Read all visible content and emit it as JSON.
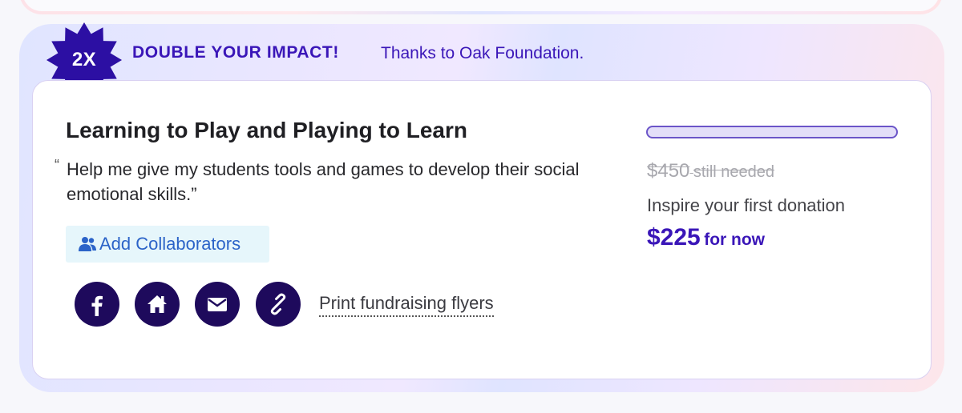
{
  "promo": {
    "badge_text": "2X",
    "title": "DOUBLE YOUR IMPACT!",
    "subtitle": "Thanks to Oak Foundation."
  },
  "project": {
    "title": "Learning to Play and Playing to Learn",
    "quote_open": "“",
    "quote": "Help me give my students tools and games to develop their social emotional skills.”"
  },
  "actions": {
    "add_collaborators": "Add Collaborators",
    "print_flyers": "Print fundraising flyers",
    "share_icons": [
      "facebook-icon",
      "home-icon",
      "email-icon",
      "link-icon"
    ]
  },
  "funding": {
    "progress": 0,
    "needed_amount": "$450",
    "needed_label": "still needed",
    "inspire_text": "Inspire your first donation",
    "now_amount": "$225",
    "now_label": "for now"
  },
  "colors": {
    "brand_purple": "#3a16b8",
    "navy": "#1e0a5c",
    "link_blue": "#2b63c8",
    "collab_bg": "#e6f6fb"
  }
}
